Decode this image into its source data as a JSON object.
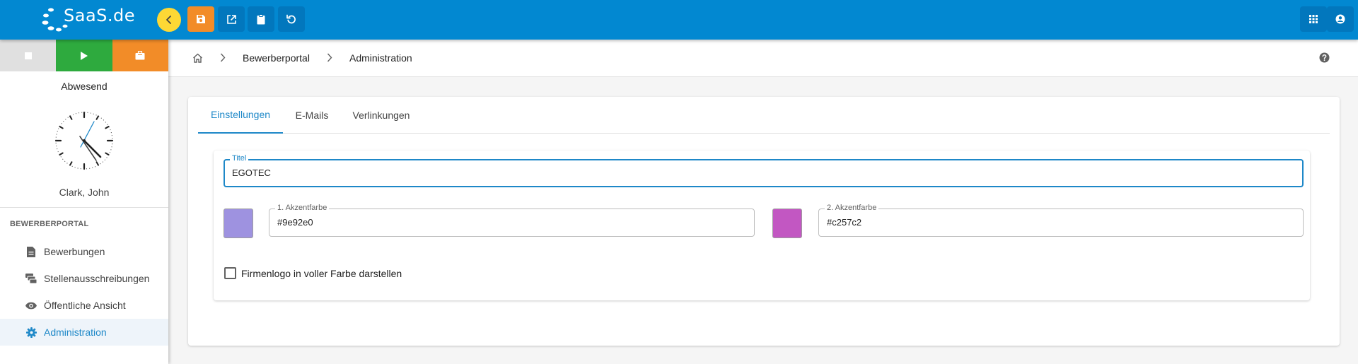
{
  "app": {
    "logo_text": "SaaS.de"
  },
  "sidebar": {
    "status": "Abwesend",
    "user_name": "Clark, John",
    "section_title": "BEWERBERPORTAL",
    "items": [
      {
        "label": "Bewerbungen",
        "icon": "document-icon"
      },
      {
        "label": "Stellenausschreibungen",
        "icon": "job-postings-icon"
      },
      {
        "label": "Öffentliche Ansicht",
        "icon": "eye-icon"
      },
      {
        "label": "Administration",
        "icon": "gear-icon",
        "active": true
      }
    ]
  },
  "breadcrumb": {
    "items": [
      "Bewerberportal",
      "Administration"
    ]
  },
  "tabs": [
    {
      "label": "Einstellungen",
      "active": true
    },
    {
      "label": "E-Mails"
    },
    {
      "label": "Verlinkungen"
    }
  ],
  "form": {
    "title_label": "Titel",
    "title_value": "EGOTEC",
    "accent1_label": "1. Akzentfarbe",
    "accent1_value": "#9e92e0",
    "accent2_label": "2. Akzentfarbe",
    "accent2_value": "#c257c2",
    "logo_checkbox_label": "Firmenlogo in voller Farbe darstellen",
    "logo_checkbox_checked": false
  },
  "colors": {
    "topbar": "#0288d1",
    "accent_blue": "#1e88c8",
    "orange": "#f28c28",
    "green": "#2eaa3e",
    "yellow": "#fdd835"
  }
}
